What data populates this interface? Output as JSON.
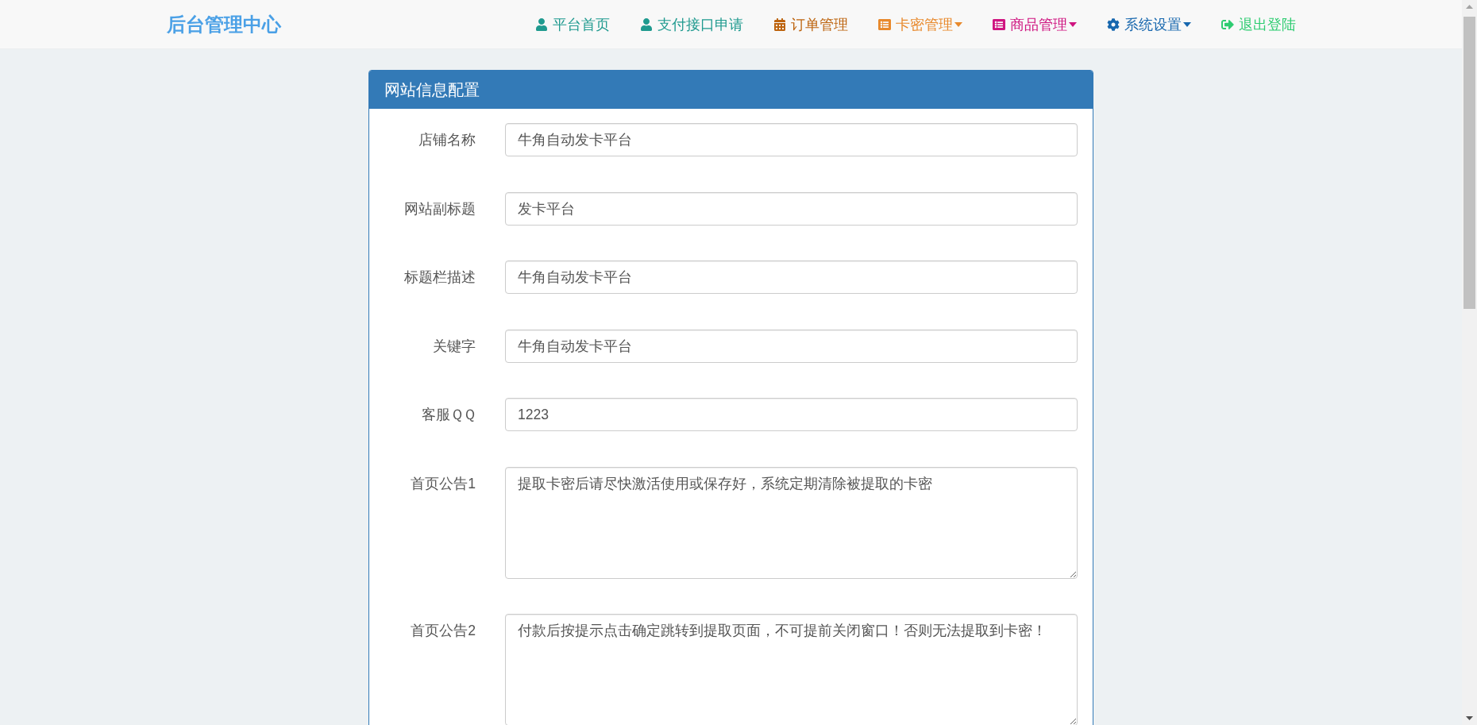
{
  "navbar": {
    "brand": "后台管理中心",
    "items": [
      {
        "label": "平台首页",
        "color": "#1f9a8f",
        "dropdown": false
      },
      {
        "label": "支付接口申请",
        "color": "#1f9a8f",
        "dropdown": false
      },
      {
        "label": "订单管理",
        "color": "#bd640f",
        "dropdown": false
      },
      {
        "label": "卡密管理",
        "color": "#e8892c",
        "dropdown": true
      },
      {
        "label": "商品管理",
        "color": "#cf1580",
        "dropdown": true
      },
      {
        "label": "系统设置",
        "color": "#1767ae",
        "dropdown": true
      },
      {
        "label": "退出登陆",
        "color": "#2ecc71",
        "dropdown": false
      }
    ]
  },
  "panel": {
    "title": "网站信息配置",
    "fields": [
      {
        "label": "店铺名称",
        "kind": "input",
        "value": "牛角自动发卡平台"
      },
      {
        "label": "网站副标题",
        "kind": "input",
        "value": "发卡平台"
      },
      {
        "label": "标题栏描述",
        "kind": "input",
        "value": "牛角自动发卡平台"
      },
      {
        "label": "关键字",
        "kind": "input",
        "value": "牛角自动发卡平台"
      },
      {
        "label": "客服ＱＱ",
        "kind": "input",
        "value": "1223"
      },
      {
        "label": "首页公告1",
        "kind": "textarea",
        "value": "提取卡密后请尽快激活使用或保存好，系统定期清除被提取的卡密"
      },
      {
        "label": "首页公告2",
        "kind": "textarea",
        "value": "付款后按提示点击确定跳转到提取页面，不可提前关闭窗口！否则无法提取到卡密！"
      }
    ]
  }
}
